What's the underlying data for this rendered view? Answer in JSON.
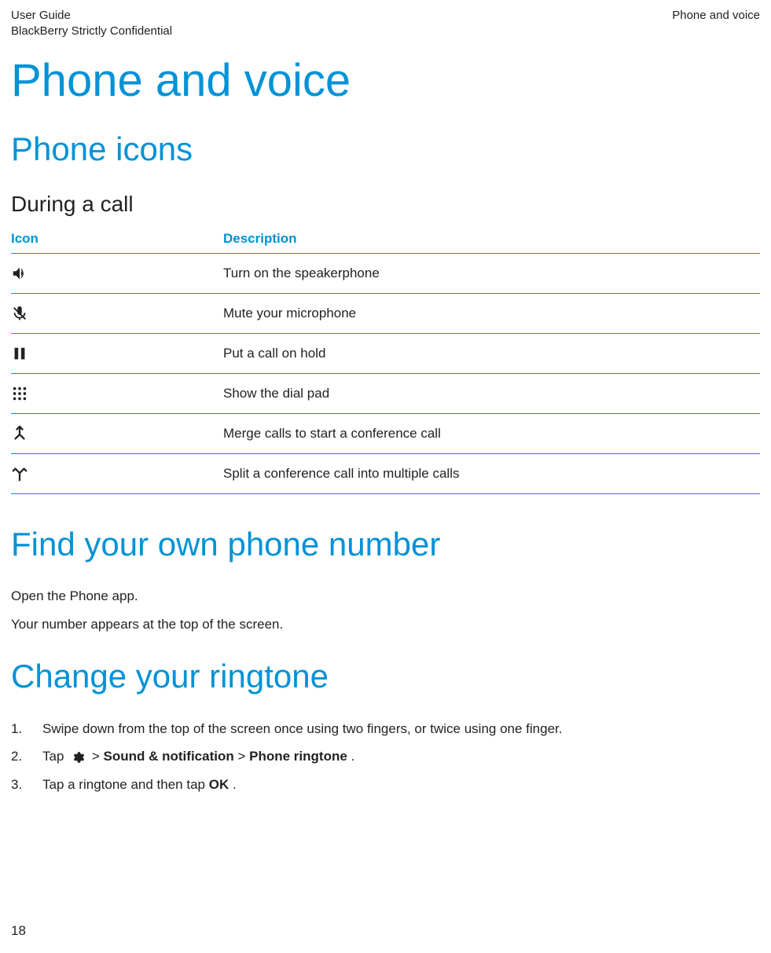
{
  "header": {
    "left_line1": "User Guide",
    "left_line2": "BlackBerry Strictly Confidential",
    "right_line1": "Phone and voice"
  },
  "title": "Phone and voice",
  "section_phone_icons": "Phone icons",
  "subsection_during_call": "During a call",
  "table_headers": {
    "icon": "Icon",
    "desc": "Description"
  },
  "rows": [
    {
      "icon_name": "speaker-icon",
      "desc": "Turn on the speakerphone"
    },
    {
      "icon_name": "mute-icon",
      "desc": "Mute your microphone"
    },
    {
      "icon_name": "hold-icon",
      "desc": "Put a call on hold"
    },
    {
      "icon_name": "dialpad-icon",
      "desc": "Show the dial pad"
    },
    {
      "icon_name": "merge-icon",
      "desc": "Merge calls to start a conference call"
    },
    {
      "icon_name": "split-icon",
      "desc": "Split a conference call into multiple calls"
    }
  ],
  "section_find_number": "Find your own phone number",
  "find_number_p1": "Open the Phone app.",
  "find_number_p2": "Your number appears at the top of the screen.",
  "section_change_ringtone": "Change your ringtone",
  "steps": {
    "s1": "Swipe down from the top of the screen once using two fingers, or twice using one finger.",
    "s2_prefix": "Tap ",
    "s2_mid1": " > ",
    "s2_bold1": "Sound & notification",
    "s2_mid2": " > ",
    "s2_bold2": "Phone ringtone",
    "s2_suffix": ".",
    "s3_prefix": "Tap a ringtone and then tap ",
    "s3_bold": "OK",
    "s3_suffix": "."
  },
  "page_number": "18"
}
